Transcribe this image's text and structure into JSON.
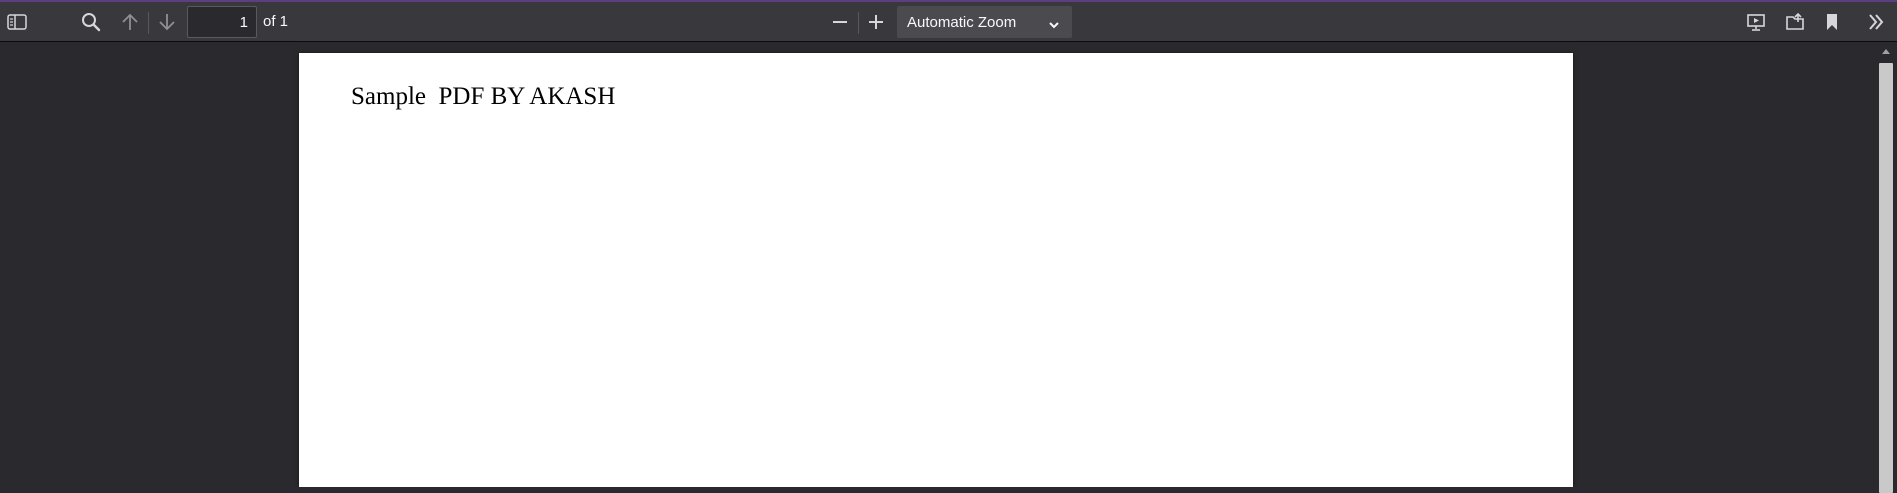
{
  "toolbar": {
    "sidebar_toggle_icon": "sidebar-toggle-icon",
    "search_icon": "search-icon",
    "prev_page_icon": "arrow-up-icon",
    "next_page_icon": "arrow-down-icon",
    "page_number_value": "1",
    "page_count_text": "of 1",
    "zoom_out_icon": "minus-icon",
    "zoom_in_icon": "plus-icon",
    "zoom_selected": "Automatic Zoom",
    "presentation_icon": "presentation-mode-icon",
    "open_file_icon": "open-file-icon",
    "bookmark_icon": "bookmark-icon",
    "tools_icon": "double-chevron-right-icon"
  },
  "document": {
    "text": "Sample  PDF BY AKASH"
  },
  "colors": {
    "toolbar_bg": "#38383d",
    "viewer_bg": "#2a2a2e",
    "accent_line": "#5b3f7e",
    "page_bg": "#ffffff",
    "icon": "#f9f9fa"
  }
}
